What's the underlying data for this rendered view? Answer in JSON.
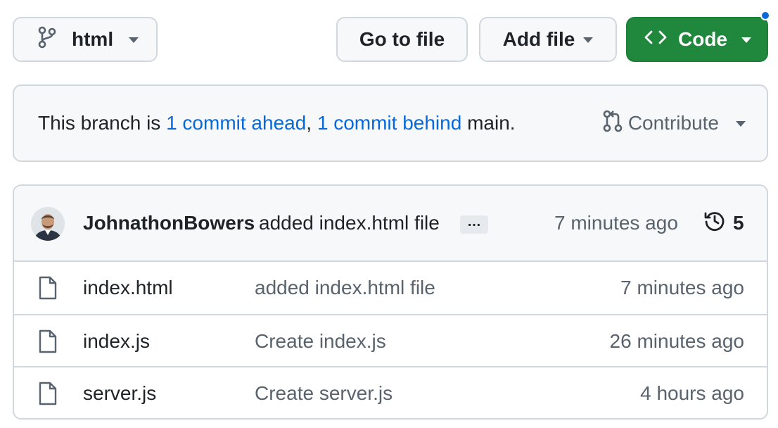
{
  "toolbar": {
    "branch_label": "html",
    "go_to_file_label": "Go to file",
    "add_file_label": "Add file",
    "code_label": "Code"
  },
  "branch_status": {
    "prefix": "This branch is ",
    "ahead_link": "1 commit ahead",
    "separator": ", ",
    "behind_link": "1 commit behind",
    "suffix": " main.",
    "contribute_label": "Contribute"
  },
  "latest_commit": {
    "author": "JohnathonBowers",
    "message": "added index.html file",
    "ellipsis": "…",
    "time": "7 minutes ago",
    "commit_count": "5"
  },
  "files": [
    {
      "name": "index.html",
      "message": "added index.html file",
      "time": "7 minutes ago"
    },
    {
      "name": "index.js",
      "message": "Create index.js",
      "time": "26 minutes ago"
    },
    {
      "name": "server.js",
      "message": "Create server.js",
      "time": "4 hours ago"
    }
  ],
  "colors": {
    "accent_link": "#0969da",
    "code_button": "#1f883d",
    "border": "#d0d7de",
    "muted_text": "#59636e"
  },
  "icons": {
    "branch": "git-branch-icon",
    "code": "code-icon",
    "contribute": "git-pull-request-icon",
    "history": "history-icon",
    "file": "file-icon"
  }
}
